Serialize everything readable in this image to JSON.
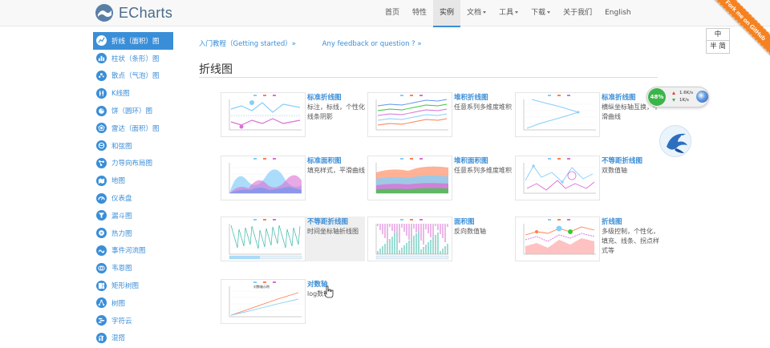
{
  "brand": {
    "name": "ECharts"
  },
  "nav": [
    {
      "label": "首页",
      "dropdown": false,
      "active": false
    },
    {
      "label": "特性",
      "dropdown": false,
      "active": false
    },
    {
      "label": "实例",
      "dropdown": false,
      "active": true
    },
    {
      "label": "文档",
      "dropdown": true,
      "active": false
    },
    {
      "label": "工具",
      "dropdown": true,
      "active": false
    },
    {
      "label": "下载",
      "dropdown": true,
      "active": false
    },
    {
      "label": "关于我们",
      "dropdown": false,
      "active": false
    },
    {
      "label": "English",
      "dropdown": false,
      "active": false
    }
  ],
  "ribbon": {
    "text": "Fork me on GitHub",
    "color": "#f58220"
  },
  "sidebar": {
    "items": [
      {
        "label": "折线（面积）图",
        "active": true,
        "icon": "line-chart-icon"
      },
      {
        "label": "柱状（条形）图",
        "active": false,
        "icon": "bar-chart-icon"
      },
      {
        "label": "散点（气泡）图",
        "active": false,
        "icon": "scatter-chart-icon"
      },
      {
        "label": "K线图",
        "active": false,
        "icon": "candlestick-chart-icon"
      },
      {
        "label": "饼（圆环）图",
        "active": false,
        "icon": "pie-chart-icon"
      },
      {
        "label": "雷达（面积）图",
        "active": false,
        "icon": "radar-chart-icon"
      },
      {
        "label": "和弦图",
        "active": false,
        "icon": "chord-chart-icon"
      },
      {
        "label": "力导向布局图",
        "active": false,
        "icon": "force-chart-icon"
      },
      {
        "label": "地图",
        "active": false,
        "icon": "map-chart-icon"
      },
      {
        "label": "仪表盘",
        "active": false,
        "icon": "gauge-chart-icon"
      },
      {
        "label": "漏斗图",
        "active": false,
        "icon": "funnel-chart-icon"
      },
      {
        "label": "热力图",
        "active": false,
        "icon": "heatmap-chart-icon"
      },
      {
        "label": "事件河流图",
        "active": false,
        "icon": "eventriver-chart-icon"
      },
      {
        "label": "韦恩图",
        "active": false,
        "icon": "venn-chart-icon"
      },
      {
        "label": "矩形树图",
        "active": false,
        "icon": "treemap-chart-icon"
      },
      {
        "label": "树图",
        "active": false,
        "icon": "tree-chart-icon"
      },
      {
        "label": "字符云",
        "active": false,
        "icon": "wordcloud-chart-icon"
      },
      {
        "label": "混搭",
        "active": false,
        "icon": "mix-chart-icon"
      }
    ]
  },
  "links": {
    "getting_started": "入门教程（Getting started）»",
    "feedback": "Any feedback or question ? »"
  },
  "page_title": "折线图",
  "cards": [
    {
      "title": "标准折线图",
      "desc": "标注，标线，个性化线条阴影",
      "thumb": "line"
    },
    {
      "title": "堆积折线图",
      "desc": "任意系列多维度堆积",
      "thumb": "stacked-line"
    },
    {
      "title": "标准折线图",
      "desc": "横纵坐标轴互换，平滑曲线",
      "thumb": "vertical-line"
    },
    {
      "title": "标准面积图",
      "desc": "填充样式，平滑曲线",
      "thumb": "area"
    },
    {
      "title": "堆积面积图",
      "desc": "任意系列多维度堆积",
      "thumb": "stacked-area"
    },
    {
      "title": "不等距折线图",
      "desc": "双数值轴",
      "thumb": "scatter-line"
    },
    {
      "title": "不等距折线图",
      "desc": "时间坐标轴折线图",
      "thumb": "time-line",
      "hover": true
    },
    {
      "title": "面积图",
      "desc": "反向数值轴",
      "thumb": "inverse-area"
    },
    {
      "title": "折线图",
      "desc": "多级控制，个性化，填充、线条、拐点样式等",
      "thumb": "styled-line"
    },
    {
      "title": "对数轴",
      "desc": "log数轴",
      "thumb": "log-axis"
    }
  ],
  "lang": {
    "top": "中",
    "bottom": "半 简"
  },
  "speed": {
    "percent": "48%",
    "up": "1.6K/s",
    "down": "1K/s"
  },
  "colors": {
    "accent": "#3a8ed8",
    "ribbon": "#f58220",
    "speed_ok": "#3bb54a"
  }
}
